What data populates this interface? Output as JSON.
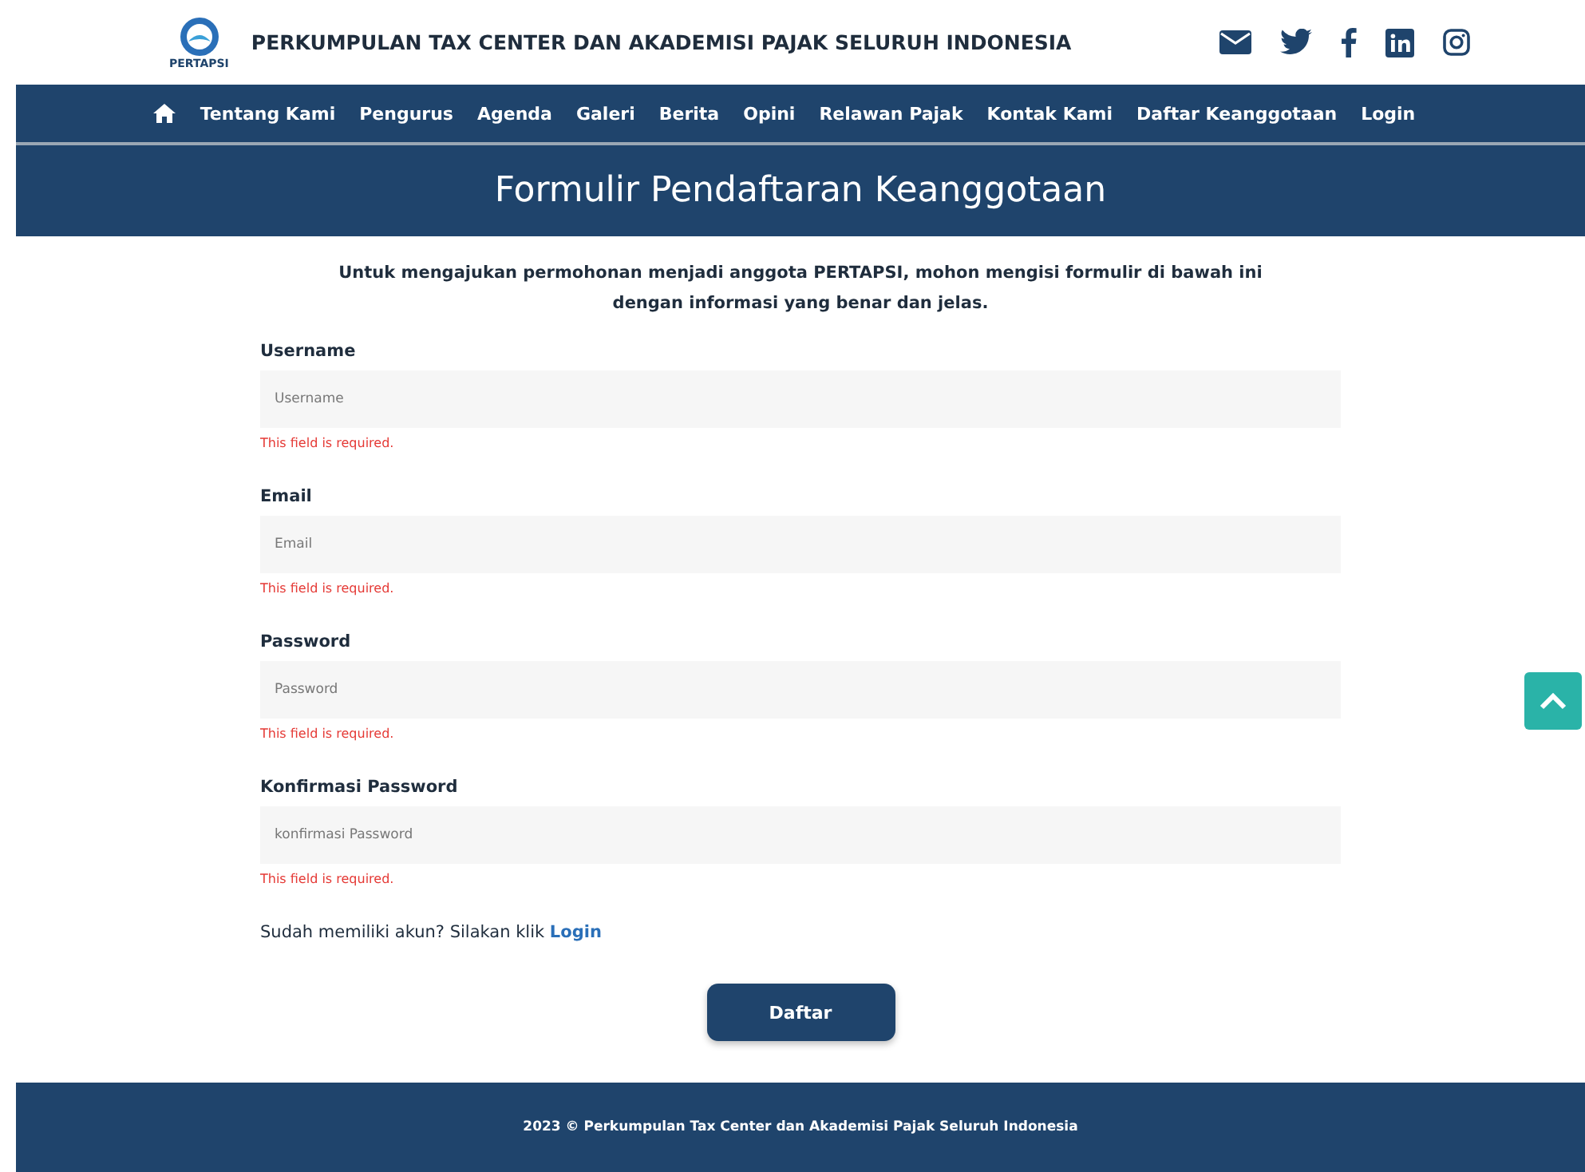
{
  "header": {
    "logo_text": "PERTAPSI",
    "title": "PERKUMPULAN TAX CENTER DAN AKADEMISI PAJAK SELURUH INDONESIA"
  },
  "nav": [
    "Tentang Kami",
    "Pengurus",
    "Agenda",
    "Galeri",
    "Berita",
    "Opini",
    "Relawan Pajak",
    "Kontak Kami",
    "Daftar Keanggotaan",
    "Login"
  ],
  "page_title": "Formulir Pendaftaran Keanggotaan",
  "intro": "Untuk mengajukan permohonan menjadi anggota PERTAPSI, mohon mengisi formulir di bawah ini dengan informasi yang benar dan jelas.",
  "fields": [
    {
      "label": "Username",
      "placeholder": "Username",
      "error": "This field is required."
    },
    {
      "label": "Email",
      "placeholder": "Email",
      "error": "This field is required."
    },
    {
      "label": "Password",
      "placeholder": "Password",
      "error": "This field is required."
    },
    {
      "label": "Konfirmasi Password",
      "placeholder": "konfirmasi Password",
      "error": "This field is required."
    }
  ],
  "login_prompt": {
    "text": "Sudah memiliki akun? Silakan klik",
    "link": "Login"
  },
  "submit": "Daftar",
  "footer": "2023 © Perkumpulan Tax Center dan Akademisi Pajak Seluruh Indonesia"
}
